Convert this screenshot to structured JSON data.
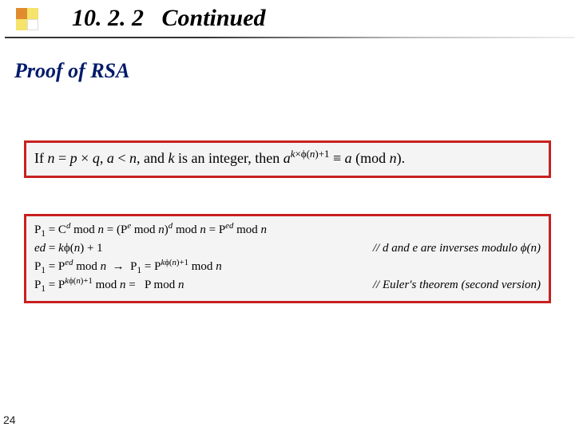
{
  "header": {
    "section_number": "10. 2. 2",
    "section_word": "Continued"
  },
  "subtitle": "Proof of RSA",
  "theorem": {
    "prefix": "If ",
    "cond1_a": "n",
    "cond1_eq": " = ",
    "cond1_b": "p",
    "cond1_times": " × ",
    "cond1_c": "q",
    "sep1": ", ",
    "cond2_a": "a",
    "cond2_lt": " < ",
    "cond2_b": "n",
    "sep2": ", and ",
    "cond3_a": "k",
    "cond3_rest": " is an integer, then ",
    "res_base": "a",
    "res_exp_k": "k",
    "res_exp_times": "×",
    "res_exp_phi": "ϕ(",
    "res_exp_n": "n",
    "res_exp_close": ")+1",
    "res_equiv": " ≡ ",
    "res_rhs": "a",
    "res_mod_open": " (mod ",
    "res_mod_n": "n",
    "res_mod_close": ")."
  },
  "proof": {
    "rows": [
      {
        "left_html": "P<sub>1</sub> = C<sup><span class='it'>d</span></sup> mod <span class='it'>n</span> = (P<sup><span class='it'>e</span></sup> mod <span class='it'>n</span>)<sup><span class='it'>d</span></sup> mod <span class='it'>n</span> = P<sup><span class='it'>ed</span></sup> mod <span class='it'>n</span>",
        "right_html": ""
      },
      {
        "left_html": "<span class='it'>ed</span> = <span class='it'>k</span>ϕ(<span class='it'>n</span>) + 1",
        "right_html": "// <span class='it'>d</span> and <span class='it'>e</span> are inverses modulo ϕ(<span class='it'>n</span>)"
      },
      {
        "left_html": "P<sub>1</sub> = P<sup><span class='it'>ed</span></sup> mod <span class='it'>n</span>&nbsp;&nbsp;→&nbsp;&nbsp;P<sub>1</sub> = P<sup><span class='it'>k</span>ϕ(<span class='it'>n</span>)+1</sup> mod <span class='it'>n</span>",
        "right_html": ""
      },
      {
        "left_html": "P<sub>1</sub> = P<sup><span class='it'>k</span>ϕ(<span class='it'>n</span>)+1</sup> mod <span class='it'>n</span> =&nbsp;&nbsp;&nbsp;P mod <span class='it'>n</span>",
        "right_html": "// Euler's theorem (second version)"
      }
    ]
  },
  "page_number": "24"
}
